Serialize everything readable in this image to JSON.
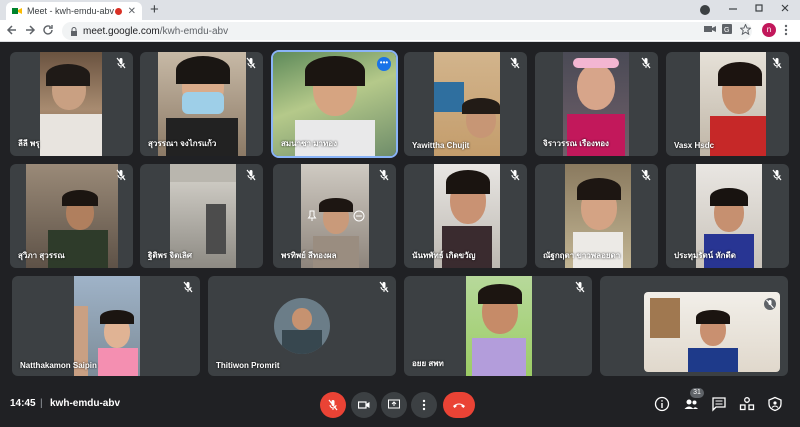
{
  "browser": {
    "tab_title": "Meet - kwh-emdu-abv",
    "close_glyph": "✕",
    "newtab_glyph": "+",
    "url_host": "meet.google.com",
    "url_path": "/kwh-emdu-abv",
    "profile_initial": "n"
  },
  "participants": [
    {
      "name": "ลีลี พรุ"
    },
    {
      "name": "สุวรรณา จงไกรแก้ว"
    },
    {
      "name": "สมนาซา มาทอง"
    },
    {
      "name": "Yawittha Chujit"
    },
    {
      "name": "จิราวรรณ เรืองทอง"
    },
    {
      "name": "Vasx Hsdc"
    },
    {
      "name": "สุวิภา สุวรรณ"
    },
    {
      "name": "ฐิติพร จิตเลิศ"
    },
    {
      "name": "พรทิพย์ สีทองผล"
    },
    {
      "name": "นันทพัทธ์ เกิดขวัญ"
    },
    {
      "name": "ณัฐกฤตา ขาวพลอยดา"
    },
    {
      "name": "ประทุมรัตน์ หักดีด"
    },
    {
      "name": "Natthakamon Saipin"
    },
    {
      "name": "Thitiwon Promrit"
    },
    {
      "name": "อยย สพท"
    },
    {
      "name": ""
    }
  ],
  "bottom": {
    "time": "14:45",
    "separator": "|",
    "meeting_code": "kwh-emdu-abv",
    "people_count": "31"
  },
  "colors": {
    "background": "#202124",
    "tile": "#3c4043",
    "hangup": "#ea4335",
    "active_outline": "#8ab4f8"
  }
}
